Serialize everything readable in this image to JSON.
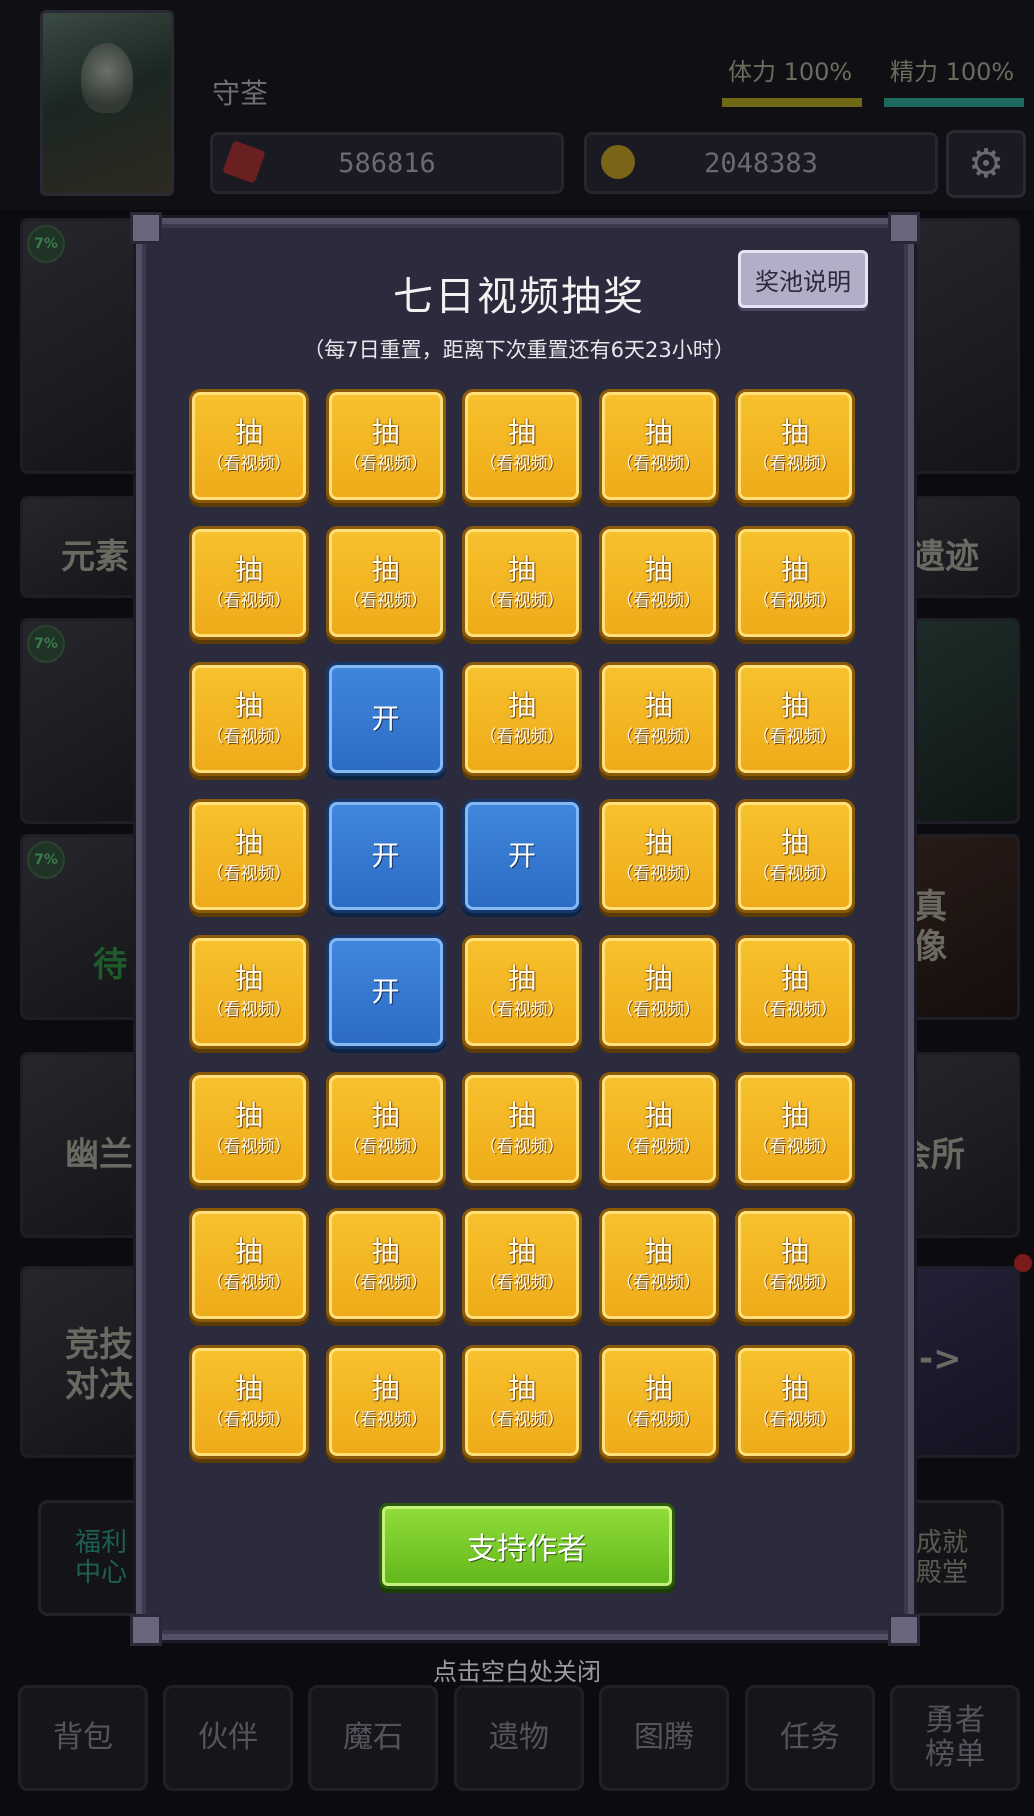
{
  "player": {
    "name": "守荃"
  },
  "stats": {
    "stamina_label": "体力 100%",
    "energy_label": "精力 100%"
  },
  "resources": {
    "gems": "586816",
    "coins": "2048383"
  },
  "settings_icon": "gear-icon",
  "background_tiles": [
    {
      "label": "",
      "badge": "7%"
    },
    {
      "label": "元素"
    },
    {
      "label": "",
      "badge": "7%"
    },
    {
      "label": "待",
      "badge": "7%"
    },
    {
      "label": "幽兰"
    },
    {
      "label": "竞技\n对决"
    },
    {
      "label": "遗迹"
    },
    {
      "label": ""
    },
    {
      "label": "真\n像"
    },
    {
      "label": "会所"
    },
    {
      "label": "->"
    }
  ],
  "side_buttons": {
    "welfare": "福利\n中心",
    "hall": "成就\n殿堂"
  },
  "modal": {
    "title": "七日视频抽奖",
    "pool_info_button": "奖池说明",
    "subtitle": "（每7日重置，距离下次重置还有6天23小时）",
    "support_button": "支持作者",
    "colors": {
      "gold": "#f2b021",
      "blue": "#3477d0",
      "green": "#7ccb2c"
    },
    "grid": [
      [
        "draw",
        "draw",
        "draw",
        "draw",
        "draw"
      ],
      [
        "draw",
        "draw",
        "draw",
        "draw",
        "draw"
      ],
      [
        "draw",
        "open",
        "draw",
        "draw",
        "draw"
      ],
      [
        "draw",
        "open",
        "open",
        "draw",
        "draw"
      ],
      [
        "draw",
        "open",
        "draw",
        "draw",
        "draw"
      ],
      [
        "draw",
        "draw",
        "draw",
        "draw",
        "draw"
      ],
      [
        "draw",
        "draw",
        "draw",
        "draw",
        "draw"
      ],
      [
        "draw",
        "draw",
        "draw",
        "draw",
        "draw"
      ]
    ],
    "draw_label": "抽",
    "draw_sub": "（看视频）",
    "open_label": "开"
  },
  "close_hint": "点击空白处关闭",
  "nav": [
    "背包",
    "伙伴",
    "魔石",
    "遗物",
    "图腾",
    "任务",
    "勇者\n榜单"
  ]
}
